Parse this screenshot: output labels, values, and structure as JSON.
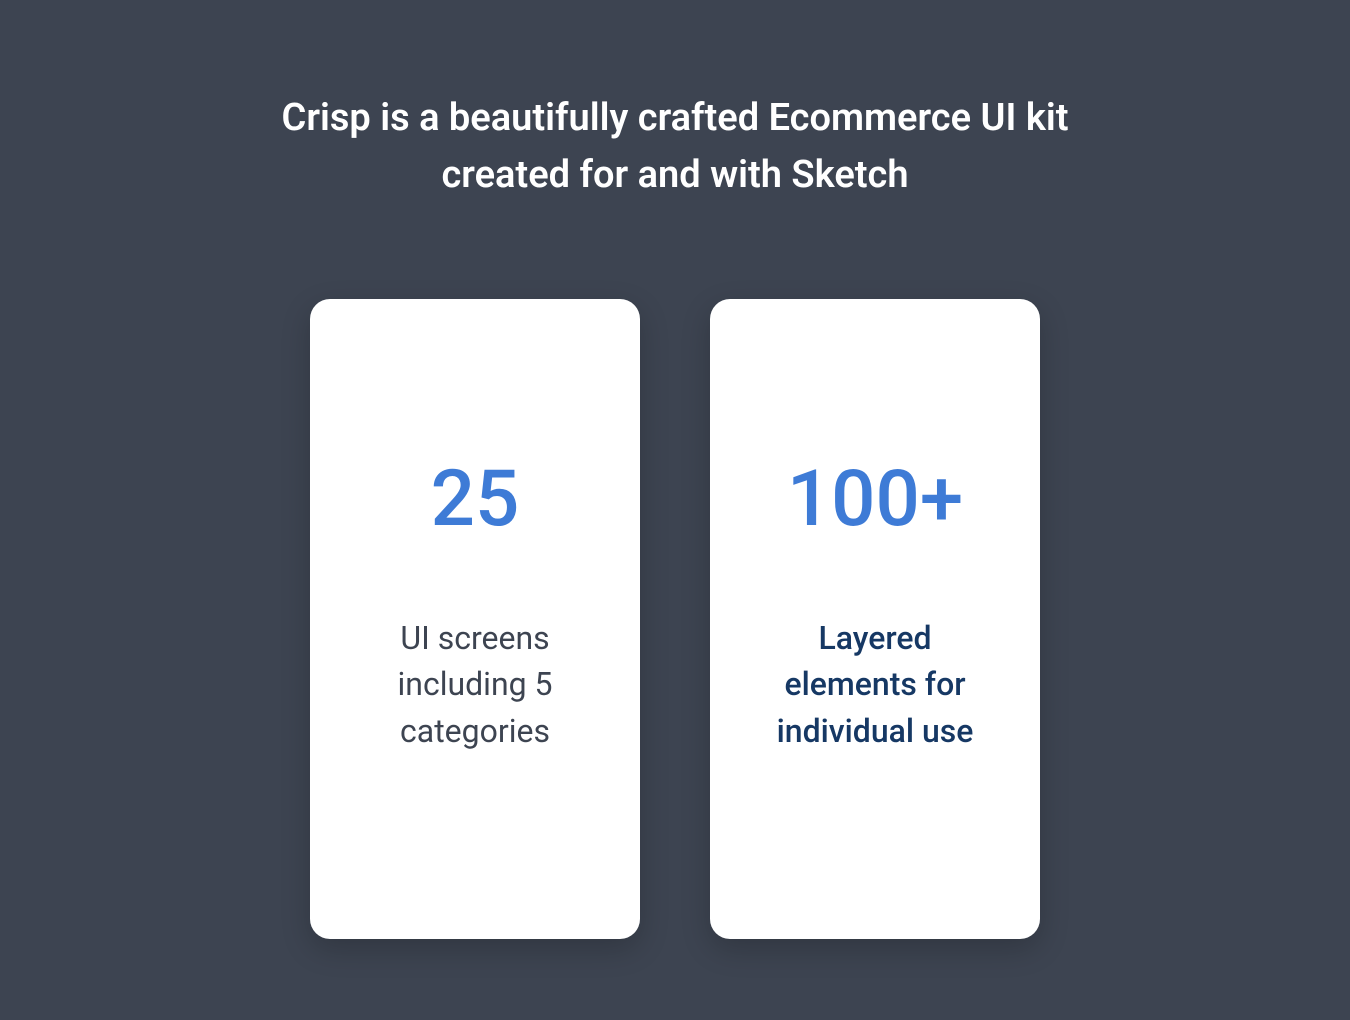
{
  "heading": "Crisp is a beautifully crafted Ecommerce UI kit created for and with Sketch",
  "cards": [
    {
      "number": "25",
      "description": "UI screens including 5 categories"
    },
    {
      "number": "100+",
      "description": "Layered elements for individual use"
    }
  ],
  "colors": {
    "background": "#3d4451",
    "accent": "#3e7bd6",
    "darkBlue": "#163864",
    "white": "#ffffff"
  }
}
